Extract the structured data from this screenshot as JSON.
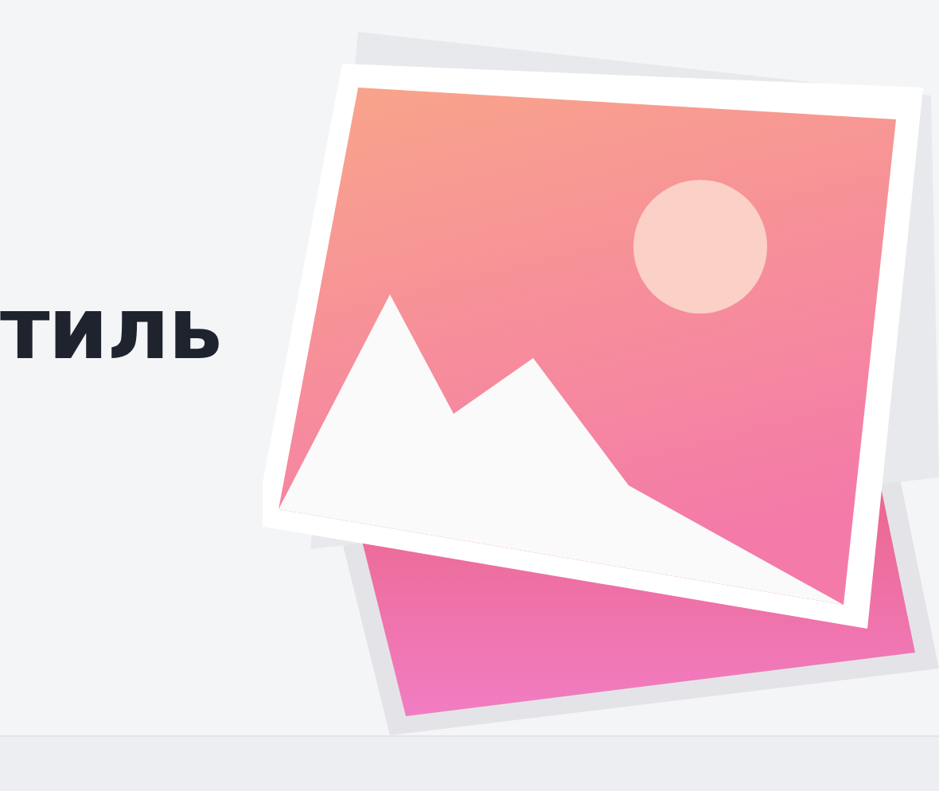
{
  "heading": "тиль"
}
